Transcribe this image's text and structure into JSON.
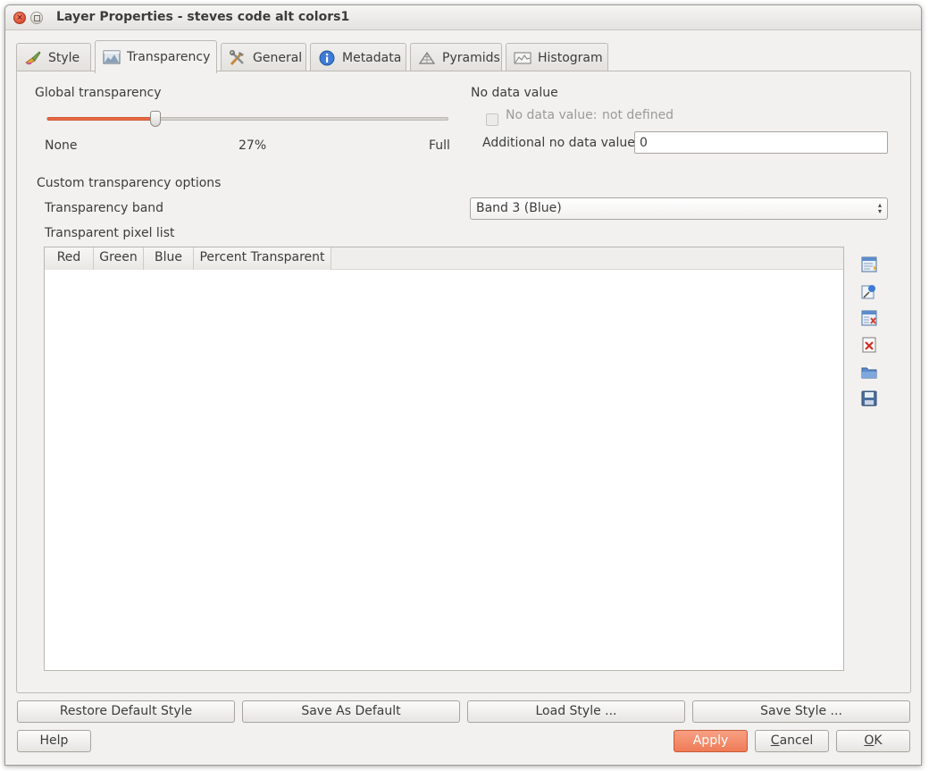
{
  "window": {
    "title": "Layer Properties - steves code alt colors1"
  },
  "tabs": [
    {
      "label": "Style",
      "icon": "paintbrush-icon"
    },
    {
      "label": "Transparency",
      "icon": "transparency-icon",
      "active": true
    },
    {
      "label": "General",
      "icon": "tools-icon"
    },
    {
      "label": "Metadata",
      "icon": "info-icon"
    },
    {
      "label": "Pyramids",
      "icon": "pyramid-icon"
    },
    {
      "label": "Histogram",
      "icon": "histogram-icon"
    }
  ],
  "global_transparency": {
    "label": "Global transparency",
    "value_percent": 27,
    "value_text": "27%",
    "min_label": "None",
    "max_label": "Full",
    "accent_color": "#e96b45"
  },
  "no_data": {
    "section_label": "No data value",
    "checkbox_label": "No data value:",
    "checkbox_value": "not defined",
    "checked": false,
    "additional_label": "Additional no data value",
    "additional_value": "0"
  },
  "custom": {
    "section_label": "Custom transparency options",
    "band_label": "Transparency band",
    "band_selected": "Band 3 (Blue)",
    "pixel_list_label": "Transparent pixel list",
    "columns": [
      "Red",
      "Green",
      "Blue",
      "Percent Transparent"
    ],
    "rows": []
  },
  "side_actions": [
    {
      "name": "add-values-manually-icon"
    },
    {
      "name": "add-values-from-display-icon"
    },
    {
      "name": "remove-row-icon"
    },
    {
      "name": "default-values-icon"
    },
    {
      "name": "import-from-file-icon"
    },
    {
      "name": "export-to-file-icon"
    }
  ],
  "buttons": {
    "restore_default_style": "Restore Default Style",
    "save_as_default": "Save As Default",
    "load_style": "Load Style ...",
    "save_style": "Save Style ...",
    "help": "Help",
    "apply": "Apply",
    "cancel_prefix": "",
    "cancel_mnemonic": "C",
    "cancel_rest": "ancel",
    "ok_mnemonic": "O",
    "ok_rest": "K"
  }
}
